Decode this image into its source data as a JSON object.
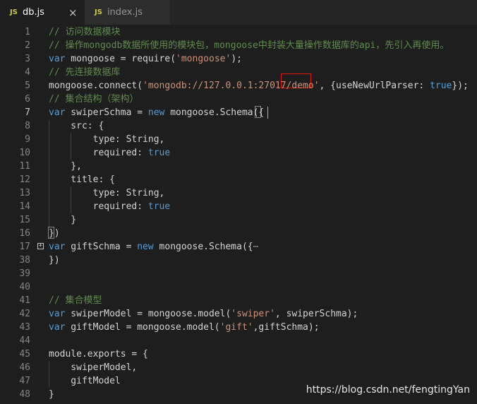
{
  "tabs": [
    {
      "icon": "JS",
      "label": "db.js",
      "close": "×"
    },
    {
      "icon": "JS",
      "label": "index.js"
    }
  ],
  "lines": [
    {
      "num": "1",
      "parts": [
        {
          "t": "// 访问数据模块",
          "c": "c"
        }
      ]
    },
    {
      "num": "2",
      "parts": [
        {
          "t": "// 操作mongodb数据所使用的模块包，mongoose中封装大量操作数据库的api，先引入再使用。",
          "c": "c"
        }
      ]
    },
    {
      "num": "3",
      "parts": [
        {
          "t": "var",
          "c": "k"
        },
        {
          "t": " mongoose = require(",
          "c": ""
        },
        {
          "t": "'mongoose'",
          "c": "s"
        },
        {
          "t": ");",
          "c": ""
        }
      ]
    },
    {
      "num": "4",
      "parts": [
        {
          "t": "// 先连接数据库",
          "c": "c"
        }
      ]
    },
    {
      "num": "5",
      "parts": [
        {
          "t": "mongoose.connect(",
          "c": ""
        },
        {
          "t": "'mongodb://127.0.0.1:27017/demo'",
          "c": "s"
        },
        {
          "t": ", {useNewUrlParser: ",
          "c": ""
        },
        {
          "t": "true",
          "c": "k"
        },
        {
          "t": "});",
          "c": ""
        }
      ]
    },
    {
      "num": "6",
      "parts": [
        {
          "t": "// 集合结构（架构）",
          "c": "c"
        }
      ]
    },
    {
      "num": "7",
      "parts": [
        {
          "t": "var",
          "c": "k"
        },
        {
          "t": " swiperSchma = ",
          "c": ""
        },
        {
          "t": "new",
          "c": "k"
        },
        {
          "t": " mongoose.Schema({",
          "c": ""
        }
      ]
    },
    {
      "num": "8",
      "parts": [
        {
          "t": "    src: {",
          "c": ""
        }
      ]
    },
    {
      "num": "9",
      "parts": [
        {
          "t": "        type: String,",
          "c": ""
        }
      ]
    },
    {
      "num": "10",
      "parts": [
        {
          "t": "        required: ",
          "c": ""
        },
        {
          "t": "true",
          "c": "k"
        }
      ]
    },
    {
      "num": "11",
      "parts": [
        {
          "t": "    },",
          "c": ""
        }
      ]
    },
    {
      "num": "12",
      "parts": [
        {
          "t": "    title: {",
          "c": ""
        }
      ]
    },
    {
      "num": "13",
      "parts": [
        {
          "t": "        type: String,",
          "c": ""
        }
      ]
    },
    {
      "num": "14",
      "parts": [
        {
          "t": "        required: ",
          "c": ""
        },
        {
          "t": "true",
          "c": "k"
        }
      ]
    },
    {
      "num": "15",
      "parts": [
        {
          "t": "    }",
          "c": ""
        }
      ]
    },
    {
      "num": "16",
      "parts": [
        {
          "t": "})",
          "c": ""
        }
      ]
    },
    {
      "num": "17",
      "parts": [
        {
          "t": "var",
          "c": "k"
        },
        {
          "t": " giftSchma = ",
          "c": ""
        },
        {
          "t": "new",
          "c": "k"
        },
        {
          "t": " mongoose.Schema({",
          "c": ""
        },
        {
          "t": "⋯",
          "c": "ellipsis"
        }
      ]
    },
    {
      "num": "38",
      "parts": [
        {
          "t": "})",
          "c": ""
        }
      ]
    },
    {
      "num": "39",
      "parts": []
    },
    {
      "num": "40",
      "parts": []
    },
    {
      "num": "41",
      "parts": [
        {
          "t": "// 集合模型",
          "c": "c"
        }
      ]
    },
    {
      "num": "42",
      "parts": [
        {
          "t": "var",
          "c": "k"
        },
        {
          "t": " swiperModel = mongoose.model(",
          "c": ""
        },
        {
          "t": "'swiper'",
          "c": "s"
        },
        {
          "t": ", swiperSchma);",
          "c": ""
        }
      ]
    },
    {
      "num": "43",
      "parts": [
        {
          "t": "var",
          "c": "k"
        },
        {
          "t": " giftModel = mongoose.model(",
          "c": ""
        },
        {
          "t": "'gift'",
          "c": "s"
        },
        {
          "t": ",giftSchma);",
          "c": ""
        }
      ]
    },
    {
      "num": "44",
      "parts": []
    },
    {
      "num": "45",
      "parts": [
        {
          "t": "module.exports = {",
          "c": ""
        }
      ]
    },
    {
      "num": "46",
      "parts": [
        {
          "t": "    swiperModel,",
          "c": ""
        }
      ]
    },
    {
      "num": "47",
      "parts": [
        {
          "t": "    giftModel",
          "c": ""
        }
      ]
    },
    {
      "num": "48",
      "parts": [
        {
          "t": "}",
          "c": ""
        }
      ]
    }
  ],
  "watermark": "https://blog.csdn.net/fengtingYan"
}
